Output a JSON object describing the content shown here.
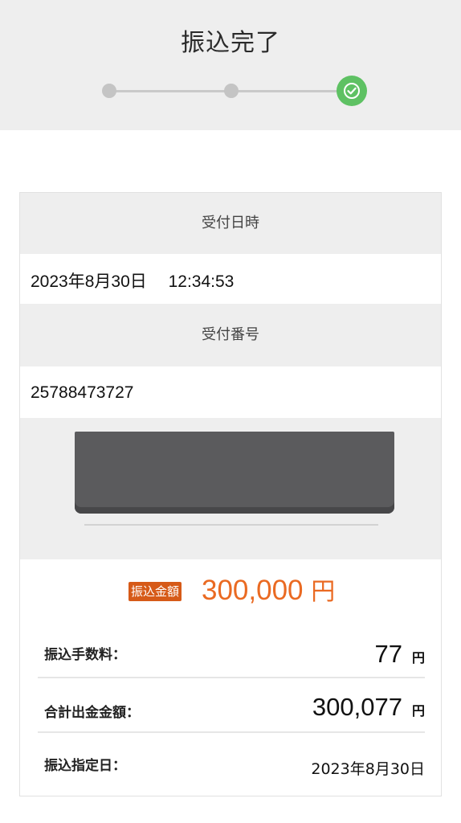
{
  "header": {
    "title": "振込完了",
    "steps": {
      "total": 3,
      "completed": 3
    },
    "colors": {
      "done": "#5ec163",
      "pending": "#c4c4c4"
    }
  },
  "receipt": {
    "datetime_label": "受付日時",
    "datetime_value": "2023年8月30日　 12:34:53",
    "number_label": "受付番号",
    "number_value": "25788473727"
  },
  "transfer": {
    "amount_badge": "振込金額",
    "amount_value": "300,000",
    "amount_unit": "円",
    "accent_color": "#ea6a22",
    "fee_label": "振込手数料：",
    "fee_value": "77",
    "fee_unit": "円",
    "total_label": "合計出金金額：",
    "total_value": "300,077",
    "total_unit": "円",
    "date_label": "振込指定日：",
    "date_value": "2023年8月30日"
  }
}
